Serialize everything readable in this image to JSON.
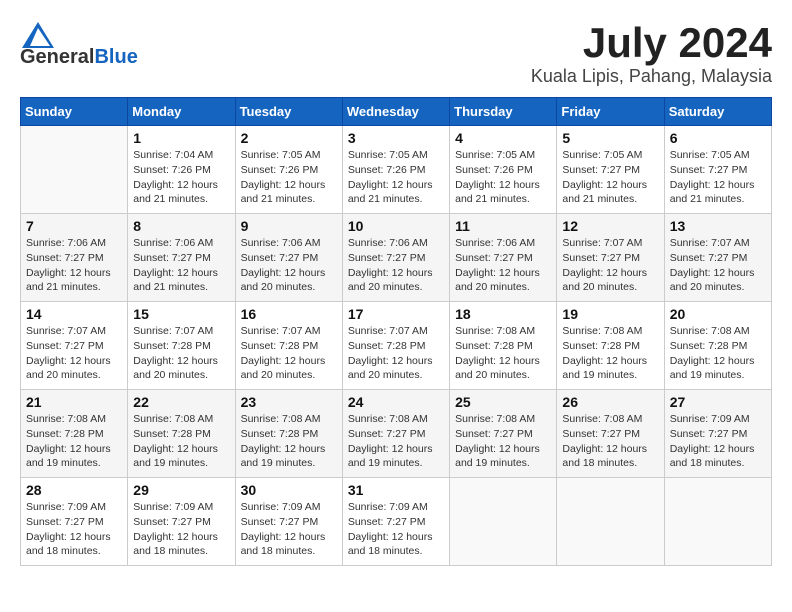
{
  "logo": {
    "general": "General",
    "blue": "Blue"
  },
  "title": {
    "month": "July 2024",
    "location": "Kuala Lipis, Pahang, Malaysia"
  },
  "calendar": {
    "headers": [
      "Sunday",
      "Monday",
      "Tuesday",
      "Wednesday",
      "Thursday",
      "Friday",
      "Saturday"
    ],
    "weeks": [
      [
        {
          "day": "",
          "sunrise": "",
          "sunset": "",
          "daylight": ""
        },
        {
          "day": "1",
          "sunrise": "Sunrise: 7:04 AM",
          "sunset": "Sunset: 7:26 PM",
          "daylight": "Daylight: 12 hours and 21 minutes."
        },
        {
          "day": "2",
          "sunrise": "Sunrise: 7:05 AM",
          "sunset": "Sunset: 7:26 PM",
          "daylight": "Daylight: 12 hours and 21 minutes."
        },
        {
          "day": "3",
          "sunrise": "Sunrise: 7:05 AM",
          "sunset": "Sunset: 7:26 PM",
          "daylight": "Daylight: 12 hours and 21 minutes."
        },
        {
          "day": "4",
          "sunrise": "Sunrise: 7:05 AM",
          "sunset": "Sunset: 7:26 PM",
          "daylight": "Daylight: 12 hours and 21 minutes."
        },
        {
          "day": "5",
          "sunrise": "Sunrise: 7:05 AM",
          "sunset": "Sunset: 7:27 PM",
          "daylight": "Daylight: 12 hours and 21 minutes."
        },
        {
          "day": "6",
          "sunrise": "Sunrise: 7:05 AM",
          "sunset": "Sunset: 7:27 PM",
          "daylight": "Daylight: 12 hours and 21 minutes."
        }
      ],
      [
        {
          "day": "7",
          "sunrise": "Sunrise: 7:06 AM",
          "sunset": "Sunset: 7:27 PM",
          "daylight": "Daylight: 12 hours and 21 minutes."
        },
        {
          "day": "8",
          "sunrise": "Sunrise: 7:06 AM",
          "sunset": "Sunset: 7:27 PM",
          "daylight": "Daylight: 12 hours and 21 minutes."
        },
        {
          "day": "9",
          "sunrise": "Sunrise: 7:06 AM",
          "sunset": "Sunset: 7:27 PM",
          "daylight": "Daylight: 12 hours and 20 minutes."
        },
        {
          "day": "10",
          "sunrise": "Sunrise: 7:06 AM",
          "sunset": "Sunset: 7:27 PM",
          "daylight": "Daylight: 12 hours and 20 minutes."
        },
        {
          "day": "11",
          "sunrise": "Sunrise: 7:06 AM",
          "sunset": "Sunset: 7:27 PM",
          "daylight": "Daylight: 12 hours and 20 minutes."
        },
        {
          "day": "12",
          "sunrise": "Sunrise: 7:07 AM",
          "sunset": "Sunset: 7:27 PM",
          "daylight": "Daylight: 12 hours and 20 minutes."
        },
        {
          "day": "13",
          "sunrise": "Sunrise: 7:07 AM",
          "sunset": "Sunset: 7:27 PM",
          "daylight": "Daylight: 12 hours and 20 minutes."
        }
      ],
      [
        {
          "day": "14",
          "sunrise": "Sunrise: 7:07 AM",
          "sunset": "Sunset: 7:27 PM",
          "daylight": "Daylight: 12 hours and 20 minutes."
        },
        {
          "day": "15",
          "sunrise": "Sunrise: 7:07 AM",
          "sunset": "Sunset: 7:28 PM",
          "daylight": "Daylight: 12 hours and 20 minutes."
        },
        {
          "day": "16",
          "sunrise": "Sunrise: 7:07 AM",
          "sunset": "Sunset: 7:28 PM",
          "daylight": "Daylight: 12 hours and 20 minutes."
        },
        {
          "day": "17",
          "sunrise": "Sunrise: 7:07 AM",
          "sunset": "Sunset: 7:28 PM",
          "daylight": "Daylight: 12 hours and 20 minutes."
        },
        {
          "day": "18",
          "sunrise": "Sunrise: 7:08 AM",
          "sunset": "Sunset: 7:28 PM",
          "daylight": "Daylight: 12 hours and 20 minutes."
        },
        {
          "day": "19",
          "sunrise": "Sunrise: 7:08 AM",
          "sunset": "Sunset: 7:28 PM",
          "daylight": "Daylight: 12 hours and 19 minutes."
        },
        {
          "day": "20",
          "sunrise": "Sunrise: 7:08 AM",
          "sunset": "Sunset: 7:28 PM",
          "daylight": "Daylight: 12 hours and 19 minutes."
        }
      ],
      [
        {
          "day": "21",
          "sunrise": "Sunrise: 7:08 AM",
          "sunset": "Sunset: 7:28 PM",
          "daylight": "Daylight: 12 hours and 19 minutes."
        },
        {
          "day": "22",
          "sunrise": "Sunrise: 7:08 AM",
          "sunset": "Sunset: 7:28 PM",
          "daylight": "Daylight: 12 hours and 19 minutes."
        },
        {
          "day": "23",
          "sunrise": "Sunrise: 7:08 AM",
          "sunset": "Sunset: 7:28 PM",
          "daylight": "Daylight: 12 hours and 19 minutes."
        },
        {
          "day": "24",
          "sunrise": "Sunrise: 7:08 AM",
          "sunset": "Sunset: 7:27 PM",
          "daylight": "Daylight: 12 hours and 19 minutes."
        },
        {
          "day": "25",
          "sunrise": "Sunrise: 7:08 AM",
          "sunset": "Sunset: 7:27 PM",
          "daylight": "Daylight: 12 hours and 19 minutes."
        },
        {
          "day": "26",
          "sunrise": "Sunrise: 7:08 AM",
          "sunset": "Sunset: 7:27 PM",
          "daylight": "Daylight: 12 hours and 18 minutes."
        },
        {
          "day": "27",
          "sunrise": "Sunrise: 7:09 AM",
          "sunset": "Sunset: 7:27 PM",
          "daylight": "Daylight: 12 hours and 18 minutes."
        }
      ],
      [
        {
          "day": "28",
          "sunrise": "Sunrise: 7:09 AM",
          "sunset": "Sunset: 7:27 PM",
          "daylight": "Daylight: 12 hours and 18 minutes."
        },
        {
          "day": "29",
          "sunrise": "Sunrise: 7:09 AM",
          "sunset": "Sunset: 7:27 PM",
          "daylight": "Daylight: 12 hours and 18 minutes."
        },
        {
          "day": "30",
          "sunrise": "Sunrise: 7:09 AM",
          "sunset": "Sunset: 7:27 PM",
          "daylight": "Daylight: 12 hours and 18 minutes."
        },
        {
          "day": "31",
          "sunrise": "Sunrise: 7:09 AM",
          "sunset": "Sunset: 7:27 PM",
          "daylight": "Daylight: 12 hours and 18 minutes."
        },
        {
          "day": "",
          "sunrise": "",
          "sunset": "",
          "daylight": ""
        },
        {
          "day": "",
          "sunrise": "",
          "sunset": "",
          "daylight": ""
        },
        {
          "day": "",
          "sunrise": "",
          "sunset": "",
          "daylight": ""
        }
      ]
    ]
  }
}
